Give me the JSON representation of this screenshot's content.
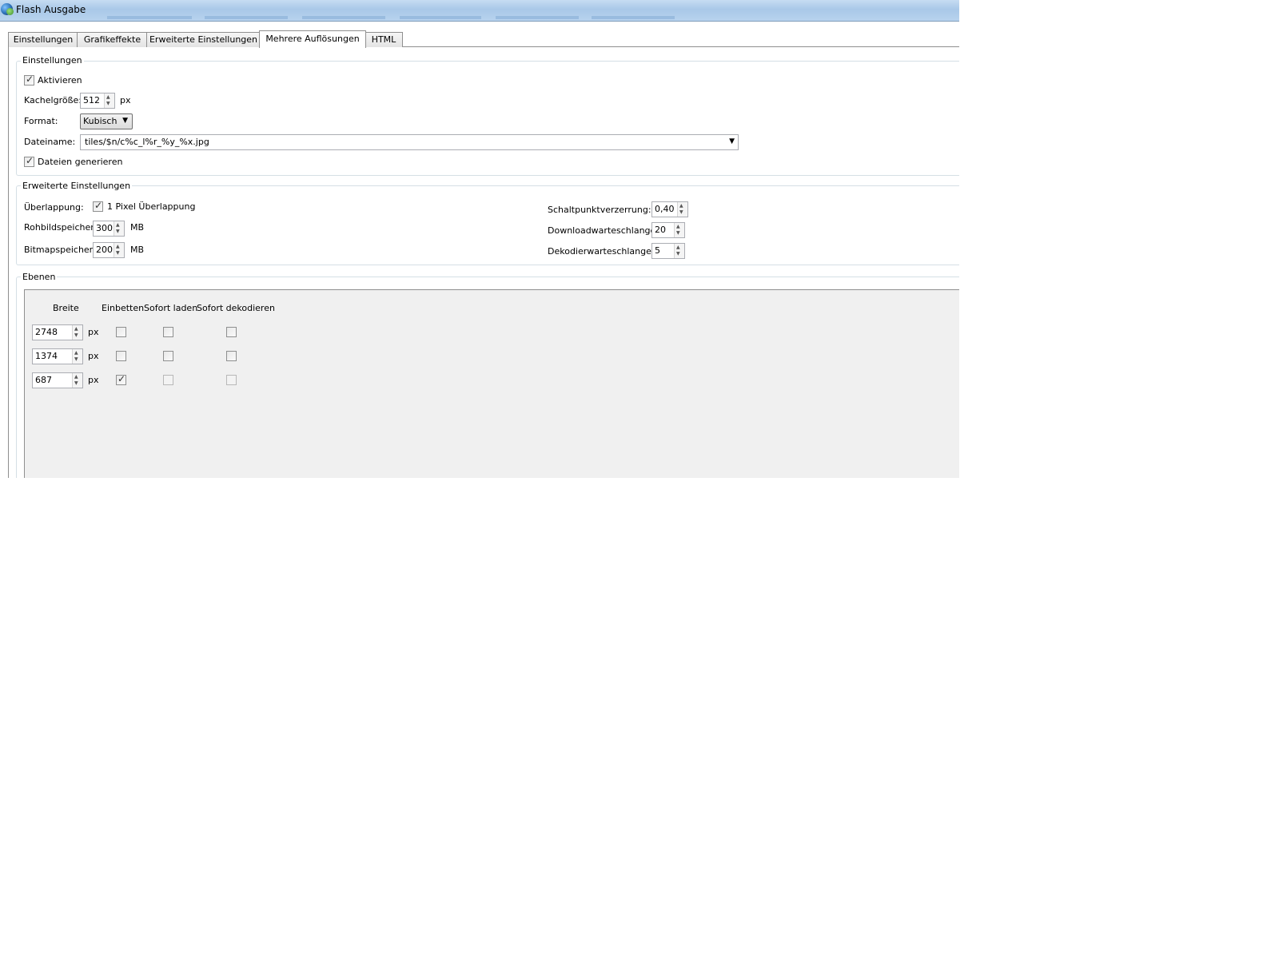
{
  "window": {
    "title": "Flash Ausgabe"
  },
  "tabs": [
    {
      "label": "Einstellungen"
    },
    {
      "label": "Grafikeffekte"
    },
    {
      "label": "Erweiterte Einstellungen"
    },
    {
      "label": "Mehrere Auflösungen",
      "active": true
    },
    {
      "label": "HTML"
    }
  ],
  "settings": {
    "legend": "Einstellungen",
    "activate_label": "Aktivieren",
    "activate_checked": true,
    "tile_size_label": "Kachelgröße:",
    "tile_size_value": "512",
    "tile_size_unit": "px",
    "format_label": "Format:",
    "format_value": "Kubisch",
    "filename_label": "Dateiname:",
    "filename_value": "tiles/$n/c%c_l%r_%y_%x.jpg",
    "generate_label": "Dateien generieren",
    "generate_checked": true
  },
  "advanced": {
    "legend": "Erweiterte Einstellungen",
    "overlap_label": "Überlappung:",
    "overlap_check_label": "1 Pixel Überlappung",
    "overlap_checked": true,
    "raw_label": "Rohbildspeicher:",
    "raw_value": "300",
    "raw_unit": "MB",
    "bitmap_label": "Bitmapspeicher:",
    "bitmap_value": "200",
    "bitmap_unit": "MB",
    "switch_label": "Schaltpunktverzerrung:",
    "switch_value": "0,40",
    "download_label": "Downloadwarteschlange:",
    "download_value": "20",
    "decode_label": "Dekodierwarteschlange:",
    "decode_value": "5"
  },
  "layers": {
    "legend": "Ebenen",
    "headers": {
      "width": "Breite",
      "embed": "Einbetten",
      "instant_load": "Sofort laden",
      "instant_decode": "Sofort dekodieren"
    },
    "unit": "px",
    "rows": [
      {
        "width": "2748",
        "embed": false,
        "instant_load": false,
        "instant_decode": false
      },
      {
        "width": "1374",
        "embed": false,
        "instant_load": false,
        "instant_decode": false
      },
      {
        "width": "687",
        "embed": true,
        "instant_load": false,
        "instant_decode": false
      }
    ]
  },
  "icons": [
    "app-icon",
    "dropdown-arrow-icon",
    "spin-up-icon",
    "spin-down-icon"
  ]
}
